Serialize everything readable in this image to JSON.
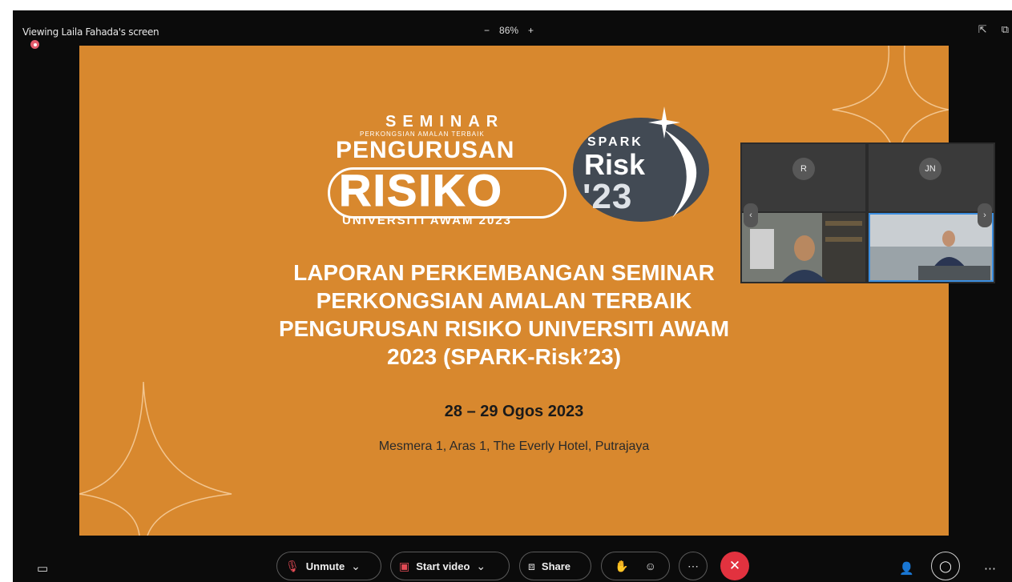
{
  "topbar": {
    "viewing_label": "Viewing Laila Fahada's screen",
    "zoom_minus": "−",
    "zoom_level": "86%",
    "zoom_plus": "+"
  },
  "slide": {
    "logo": {
      "seminar": "SEMINAR",
      "perkongsian": "PERKONGSIAN AMALAN TERBAIK",
      "pengurusan": "PENGURUSAN",
      "risiko": "RISIKO",
      "universiti": "UNIVERSITI AWAM 2023",
      "spark": "SPARK",
      "risk": "Risk",
      "year": "'23"
    },
    "title_lines": [
      "LAPORAN PERKEMBANGAN SEMINAR",
      "PERKONGSIAN AMALAN TERBAIK",
      "PENGURUSAN RISIKO UNIVERSITI AWAM",
      "2023 (SPARK-Risk’23)"
    ],
    "date": "28 – 29 Ogos 2023",
    "venue": "Mesmera 1, Aras 1, The Everly Hotel, Putrajaya"
  },
  "participants": {
    "tiles": [
      {
        "initials": "R"
      },
      {
        "initials": "JN"
      }
    ]
  },
  "controls": {
    "unmute": "Unmute",
    "start_video": "Start video",
    "share": "Share"
  },
  "colors": {
    "slide_bg": "#d8882e",
    "end_call": "#e2323f",
    "active_video_border": "#3d8fe0"
  }
}
